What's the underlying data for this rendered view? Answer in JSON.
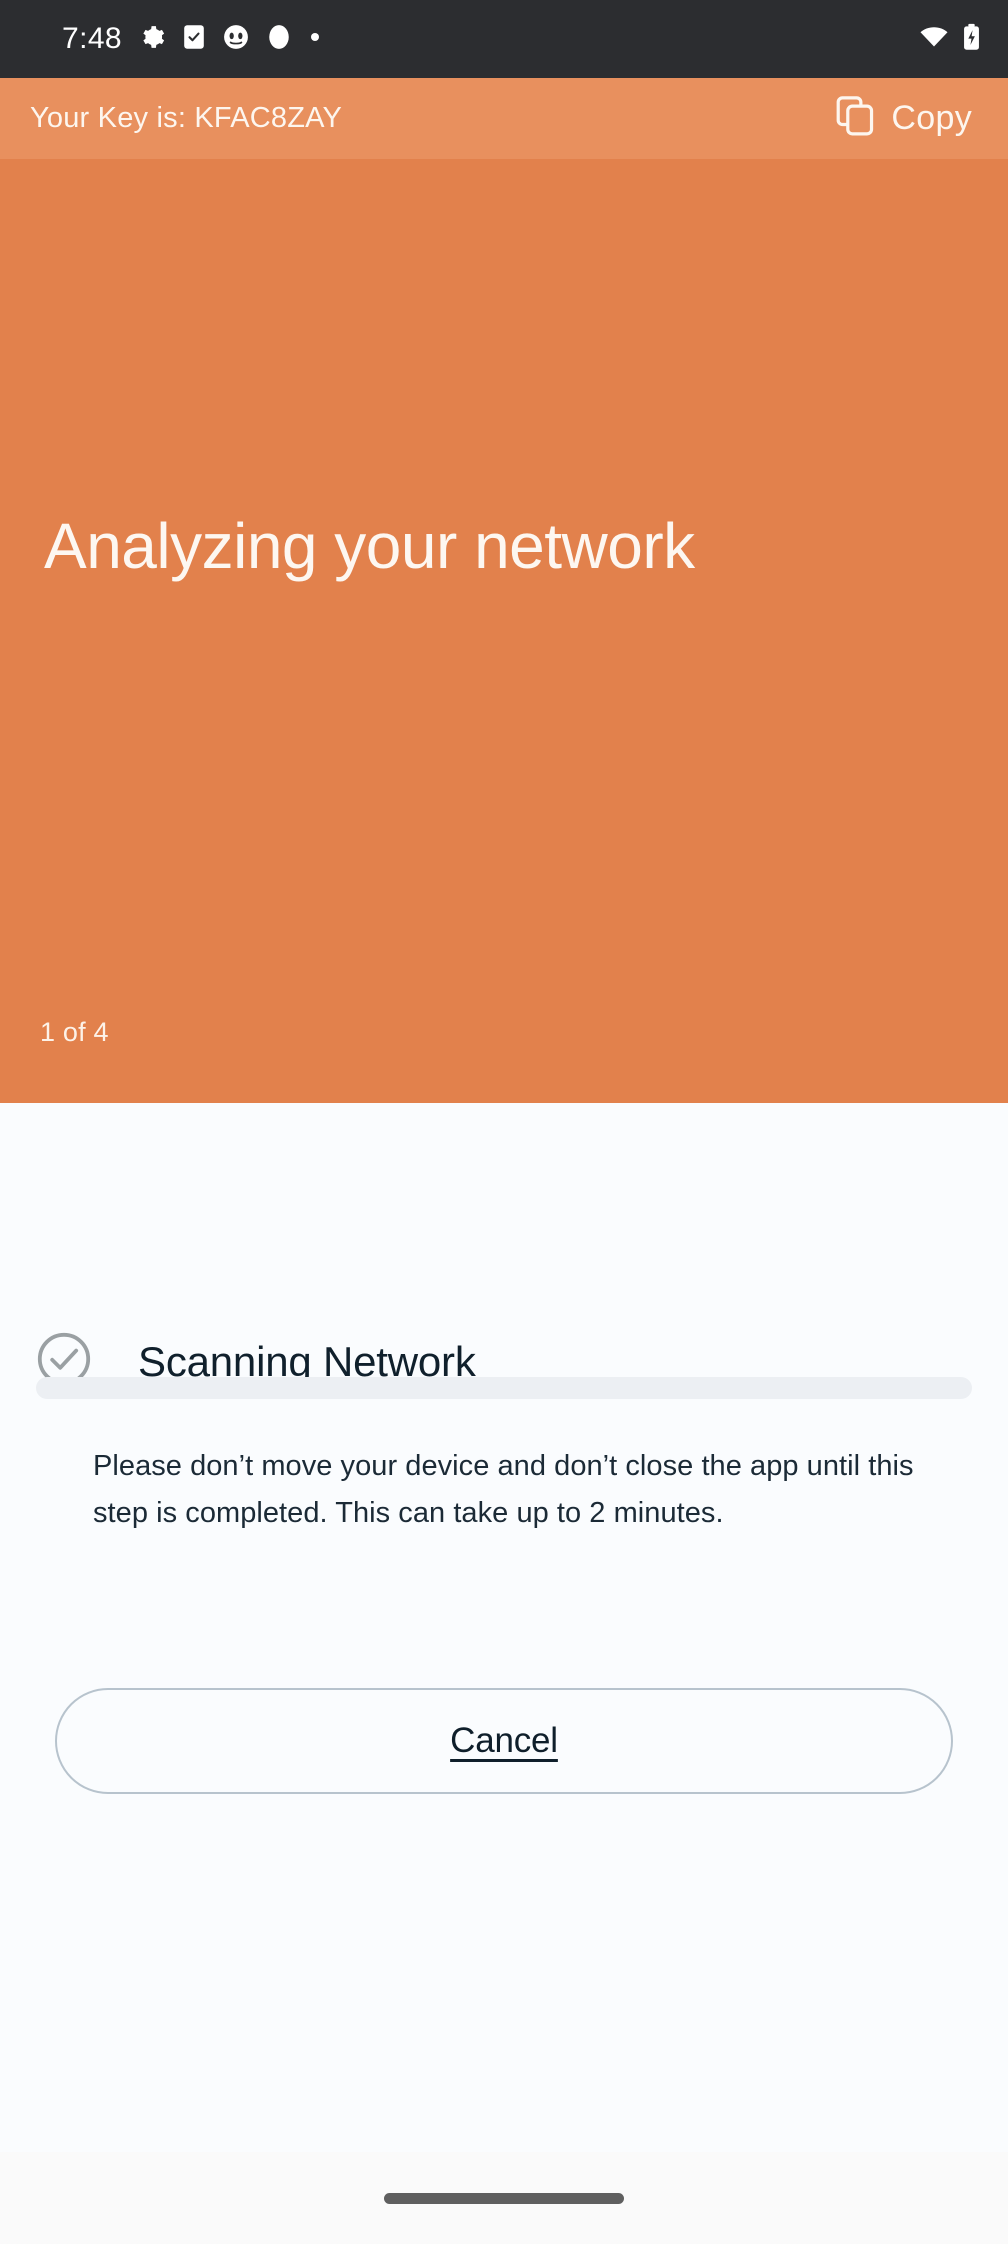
{
  "status_bar": {
    "time": "7:48",
    "left_icons": [
      "gear-icon",
      "task-checkbox-icon",
      "app-face-icon",
      "dot-circle-icon",
      "small-dot-icon"
    ],
    "right_icons": [
      "wifi-icon",
      "battery-charging-icon"
    ],
    "background": "#2c2d30"
  },
  "key_bar": {
    "key_text": "Your Key is: KFAC8ZAY",
    "copy_label": "Copy",
    "copy_icon": "copy-icon",
    "background": "#e8905e"
  },
  "hero": {
    "title": "Analyzing your network",
    "step": "1 of 4",
    "background": "#e2814c"
  },
  "step_panel": {
    "status_icon": "check-circle-icon",
    "status_title": "Scanning Network",
    "progress_percent": 0,
    "progress_track_color": "#eceff3",
    "progress_fill_color": "#e2814c",
    "body_text": "Please don’t move your device and don’t close the app until this step is completed. This can take up to 2 minutes.",
    "cancel_label": "Cancel"
  },
  "nav_bar": {
    "home_indicator": "home-gesture-pill"
  }
}
